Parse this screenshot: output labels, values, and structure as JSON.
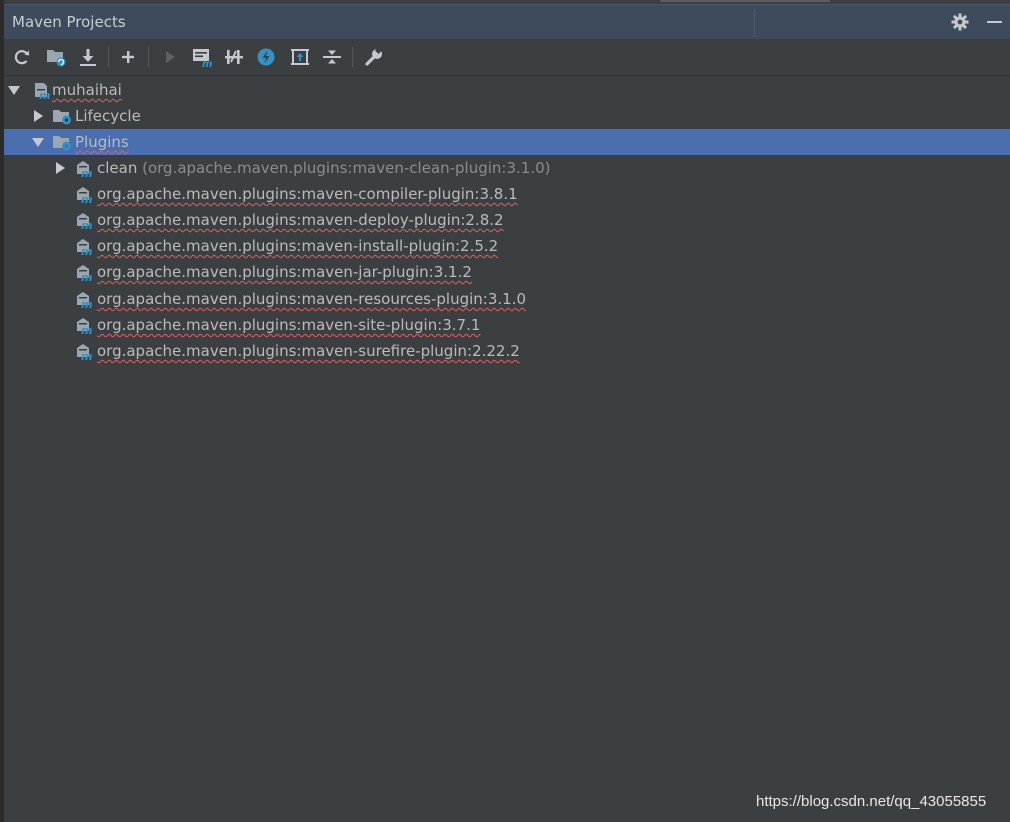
{
  "window": {
    "title": "Maven Projects"
  },
  "header_actions": [
    {
      "name": "settings",
      "icon": "gear-icon"
    },
    {
      "name": "hide",
      "icon": "minimize-icon"
    }
  ],
  "toolbar": [
    {
      "name": "reimport-all",
      "icon": "refresh-icon"
    },
    {
      "name": "generate-sources",
      "icon": "folder-generate-icon"
    },
    {
      "name": "download-sources",
      "icon": "download-icon"
    },
    {
      "name": "add-maven-project",
      "icon": "plus-icon"
    },
    {
      "name": "run-maven-build",
      "icon": "run-icon"
    },
    {
      "name": "execute-goal",
      "icon": "execute-goal-icon"
    },
    {
      "name": "toggle-offline-mode",
      "icon": "offline-toggle-icon"
    },
    {
      "name": "skip-tests",
      "icon": "skip-tests-icon"
    },
    {
      "name": "show-dependencies",
      "icon": "dependencies-icon"
    },
    {
      "name": "collapse-all",
      "icon": "collapse-all-icon"
    },
    {
      "name": "maven-settings",
      "icon": "wrench-icon"
    }
  ],
  "tree": {
    "project": "muhaihai",
    "lifecycle": "Lifecycle",
    "plugins": "Plugins",
    "clean_name": "clean",
    "clean_detail": "(org.apache.maven.plugins:maven-clean-plugin:3.1.0)",
    "plugin_items": [
      "org.apache.maven.plugins:maven-compiler-plugin:3.8.1",
      "org.apache.maven.plugins:maven-deploy-plugin:2.8.2",
      "org.apache.maven.plugins:maven-install-plugin:2.5.2",
      "org.apache.maven.plugins:maven-jar-plugin:3.1.2",
      "org.apache.maven.plugins:maven-resources-plugin:3.1.0",
      "org.apache.maven.plugins:maven-site-plugin:3.7.1",
      "org.apache.maven.plugins:maven-surefire-plugin:2.22.2"
    ]
  },
  "watermark": "https://blog.csdn.net/qq_43055855",
  "colors": {
    "background": "#3c3f41",
    "header": "#3d4b5c",
    "selection": "#4b6eaf",
    "text": "#bbbbbb",
    "accent_blue": "#3592c4"
  }
}
